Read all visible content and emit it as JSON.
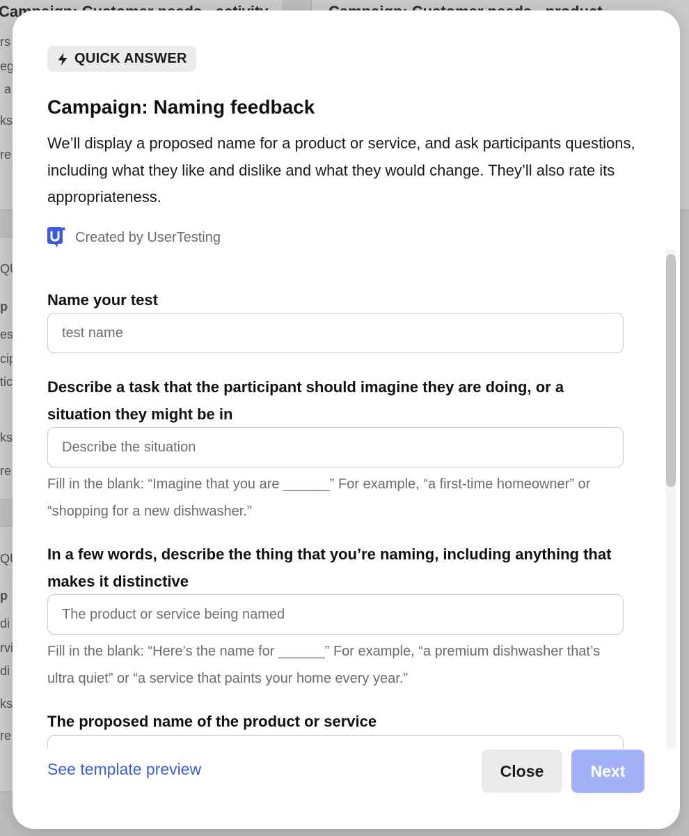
{
  "background": {
    "cards": [
      {
        "title": "Campaign: Customer needs - activity"
      },
      {
        "title": "Campaign: Customer needs - product"
      }
    ],
    "fragments": [
      "rs",
      "eg",
      "a",
      "ks",
      "re",
      "QU",
      "p",
      "es",
      "cip",
      "tic",
      "ks",
      "re",
      "QU",
      "p",
      "di",
      "rvi",
      "di",
      "ks",
      "re"
    ]
  },
  "modal": {
    "badge": {
      "icon": "lightning-bolt-icon",
      "label": "QUICK ANSWER"
    },
    "title": "Campaign: Naming feedback",
    "description": "We’ll display a proposed name for a product or service, and ask participants questions, including what they like and dislike and what they would change. They’ll also rate its appropriateness.",
    "creator": {
      "icon": "usertesting-logo",
      "label": "Created by UserTesting"
    },
    "fields": [
      {
        "label": "Name your test",
        "placeholder": "test name",
        "hint": ""
      },
      {
        "label": "Describe a task that the participant should imagine they are doing, or a situation they might be in",
        "placeholder": "Describe the situation",
        "hint": "Fill in the blank: “Imagine that you are ______” For example, “a first-time homeowner” or “shopping for a new dishwasher.”"
      },
      {
        "label": "In a few words, describe the thing that you’re naming, including anything that makes it distinctive",
        "placeholder": "The product or service being named",
        "hint": "Fill in the blank: “Here’s the name for ______” For example, “a premium dishwasher that’s ultra quiet” or “a service that paints your home every year.”"
      },
      {
        "label": "The proposed name of the product or service",
        "placeholder": "",
        "hint": ""
      }
    ],
    "footer": {
      "preview_link": "See template preview",
      "close_label": "Close",
      "next_label": "Next"
    },
    "colors": {
      "link": "#3c5ed6",
      "next_disabled": "#a3b1f7",
      "logo": "#3d5bd9"
    }
  }
}
